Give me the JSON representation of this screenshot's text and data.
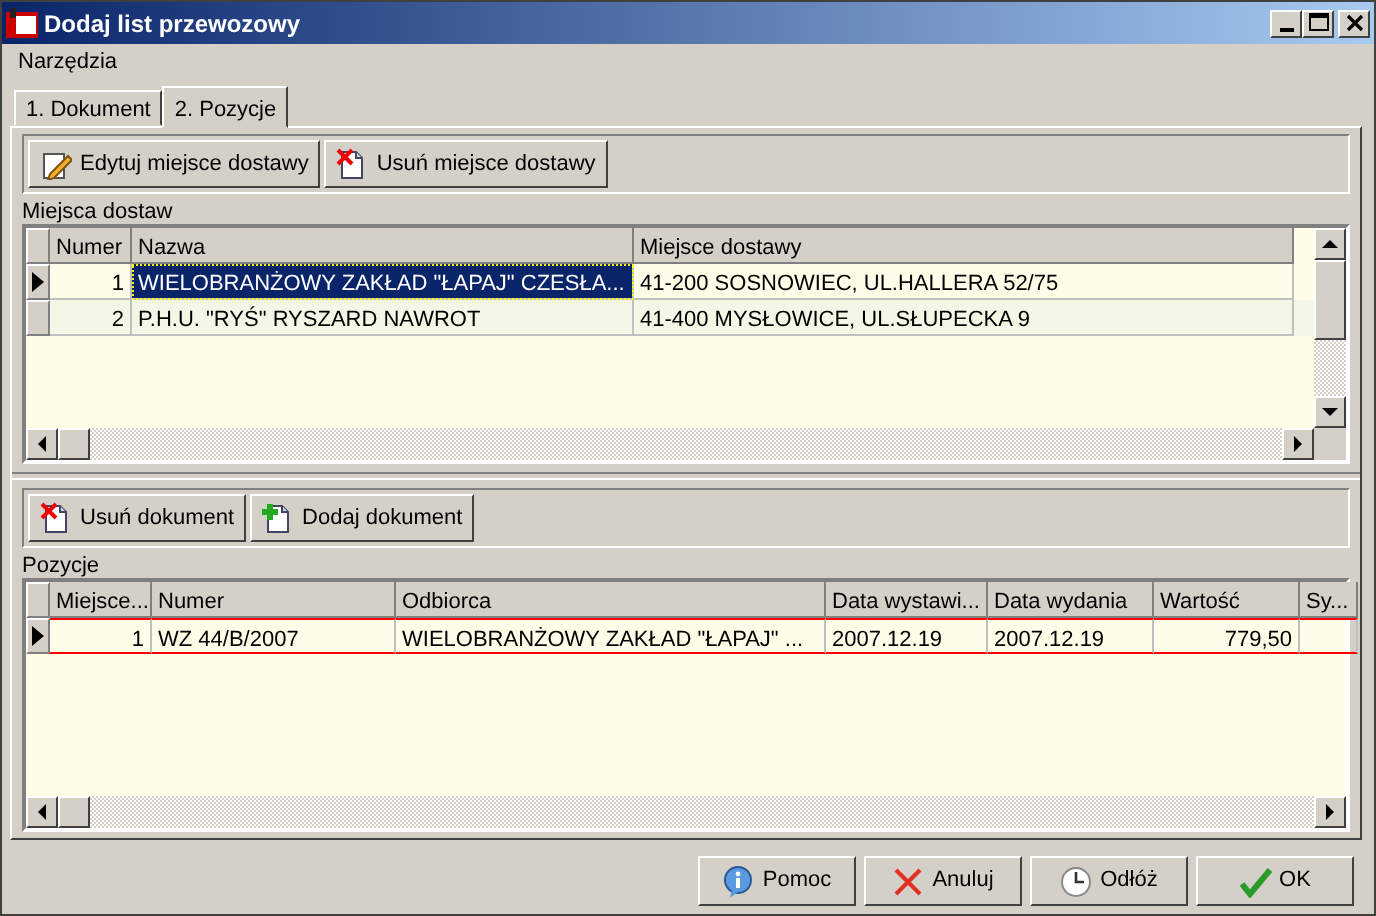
{
  "window": {
    "title": "Dodaj list przewozowy"
  },
  "menu": [
    "Narzędzia"
  ],
  "tabs": [
    {
      "label": "1. Dokument",
      "selected": false
    },
    {
      "label": "2. Pozycje",
      "selected": true
    }
  ],
  "toolbar_top": [
    {
      "label": "Edytuj miejsce dostawy",
      "kind": "edit"
    },
    {
      "label": "Usuń miejsce dostawy",
      "kind": "delete"
    }
  ],
  "delivery_places": {
    "title": "Miejsca dostaw",
    "columns": [
      "Numer",
      "Nazwa",
      "Miejsce dostawy"
    ],
    "rows": [
      {
        "cells": [
          "1",
          "WIELOBRANŻOWY ZAKŁAD \"ŁAPAJ\" CZESŁA...",
          "41-200 SOSNOWIEC, UL.HALLERA 52/75"
        ],
        "selected": true
      },
      {
        "cells": [
          "2",
          "P.H.U. \"RYŚ\" RYSZARD NAWROT",
          "41-400 MYSŁOWICE, UL.SŁUPECKA 9"
        ],
        "selected": false
      }
    ]
  },
  "toolbar_bottom": [
    {
      "label": "Usuń dokument",
      "kind": "delete"
    },
    {
      "label": "Dodaj dokument",
      "kind": "add"
    }
  ],
  "positions": {
    "title": "Pozycje",
    "columns": [
      "Miejsce...",
      "Numer",
      "Odbiorca",
      "Data wystawi...",
      "Data wydania",
      "Wartość",
      "Sy..."
    ],
    "rows": [
      {
        "cells": [
          "1",
          "WZ  44/B/2007",
          "WIELOBRANŻOWY ZAKŁAD \"ŁAPAJ\" ...",
          "2007.12.19",
          "2007.12.19",
          "779,50"
        ],
        "selected": true
      }
    ]
  },
  "buttons": [
    {
      "label": "Pomoc",
      "kind": "help"
    },
    {
      "label": "Anuluj",
      "kind": "cancel"
    },
    {
      "label": "Odłóż",
      "kind": "postpone"
    },
    {
      "label": "OK",
      "kind": "ok"
    }
  ]
}
